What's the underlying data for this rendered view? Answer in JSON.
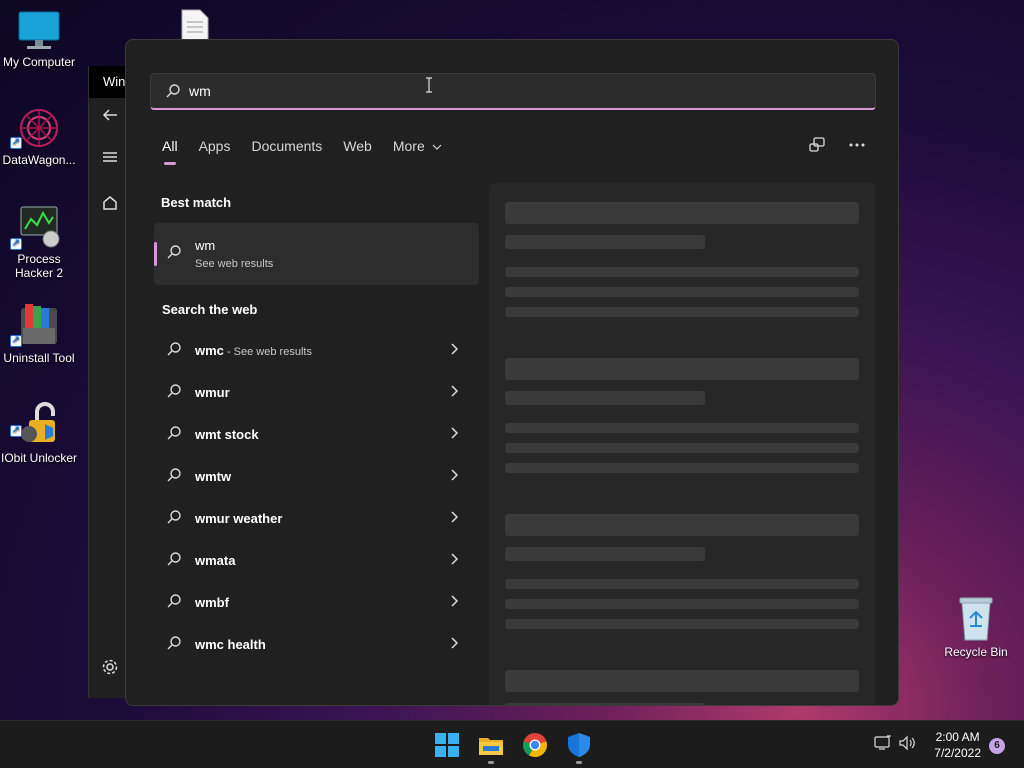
{
  "desktop": {
    "icons": [
      {
        "label": "My Computer"
      },
      {
        "label": "DataWagon..."
      },
      {
        "label": "Process Hacker 2"
      },
      {
        "label": "Uninstall Tool"
      },
      {
        "label": "IObit Unlocker"
      }
    ],
    "recycle_bin": {
      "label": "Recycle Bin"
    }
  },
  "background_window": {
    "title": "Win"
  },
  "search": {
    "query": "wm",
    "tabs": [
      {
        "label": "All",
        "active": true
      },
      {
        "label": "Apps"
      },
      {
        "label": "Documents"
      },
      {
        "label": "Web"
      },
      {
        "label": "More"
      }
    ],
    "best_match": {
      "heading": "Best match",
      "title": "wm",
      "subtitle": "See web results"
    },
    "web": {
      "heading": "Search the web",
      "results": [
        {
          "query": "wmc",
          "suffix": " - See web results"
        },
        {
          "query": "wmur"
        },
        {
          "query": "wmt stock"
        },
        {
          "query": "wmtw"
        },
        {
          "query": "wmur weather"
        },
        {
          "query": "wmata"
        },
        {
          "query": "wmbf"
        },
        {
          "query": "wmc health"
        }
      ]
    }
  },
  "taskbar": {
    "time": "2:00 AM",
    "date": "7/2/2022",
    "notification_count": "6",
    "pinned": [
      "windows-start-icon",
      "file-explorer-icon",
      "chrome-icon",
      "windows-security-icon"
    ]
  },
  "colors": {
    "accent": "#d59ad6",
    "panel_bg": "#202020",
    "taskbar_bg": "#1c1c1c"
  }
}
